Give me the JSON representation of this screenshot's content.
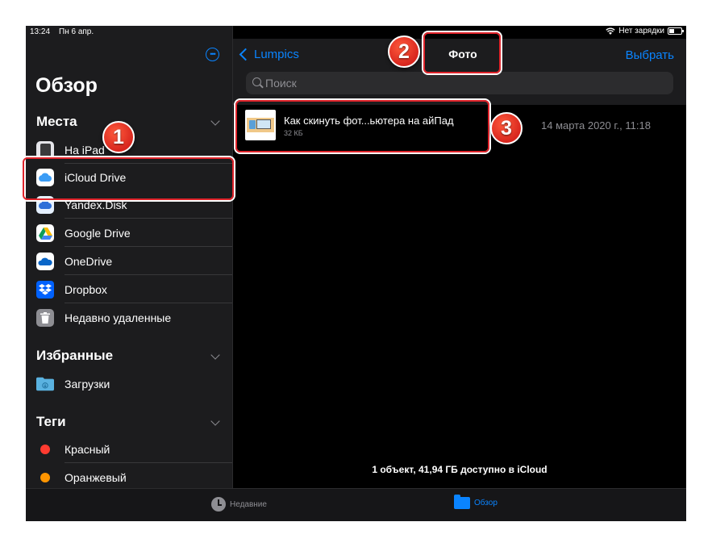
{
  "status_bar": {
    "time": "13:24",
    "date": "Пн 6 апр.",
    "battery_text": "Нет зарядки"
  },
  "sidebar": {
    "title": "Обзор",
    "sections": {
      "places": {
        "title": "Места",
        "items": [
          {
            "label": "На iPad",
            "icon": "ipad-icon"
          },
          {
            "label": "iCloud Drive",
            "icon": "icloud-icon"
          },
          {
            "label": "Yandex.Disk",
            "icon": "yandex-disk-icon"
          },
          {
            "label": "Google Drive",
            "icon": "google-drive-icon"
          },
          {
            "label": "OneDrive",
            "icon": "onedrive-icon"
          },
          {
            "label": "Dropbox",
            "icon": "dropbox-icon"
          },
          {
            "label": "Недавно удаленные",
            "icon": "trash-icon"
          }
        ]
      },
      "favorites": {
        "title": "Избранные",
        "items": [
          {
            "label": "Загрузки",
            "icon": "downloads-folder-icon"
          }
        ]
      },
      "tags": {
        "title": "Теги",
        "items": [
          {
            "label": "Красный",
            "color": "#ff3b30"
          },
          {
            "label": "Оранжевый",
            "color": "#ff9500"
          }
        ]
      }
    }
  },
  "header": {
    "back_label": "Lumpics",
    "title": "Фото",
    "select_label": "Выбрать"
  },
  "search": {
    "placeholder": "Поиск"
  },
  "files": [
    {
      "name": "Как скинуть фот...ьютера на айПад",
      "size": "32 КБ",
      "date": "14 марта 2020 г., 11:18"
    }
  ],
  "footer_info": "1 объект, 41,94 ГБ доступно в iCloud",
  "tabbar": {
    "recents_label": "Недавние",
    "browse_label": "Обзор"
  },
  "annotations": {
    "badge_1": "1",
    "badge_2": "2",
    "badge_3": "3"
  },
  "colors": {
    "accent": "#0a84ff",
    "highlight": "#e0242b",
    "background": "#000000",
    "sidebar": "#1c1c1e"
  }
}
